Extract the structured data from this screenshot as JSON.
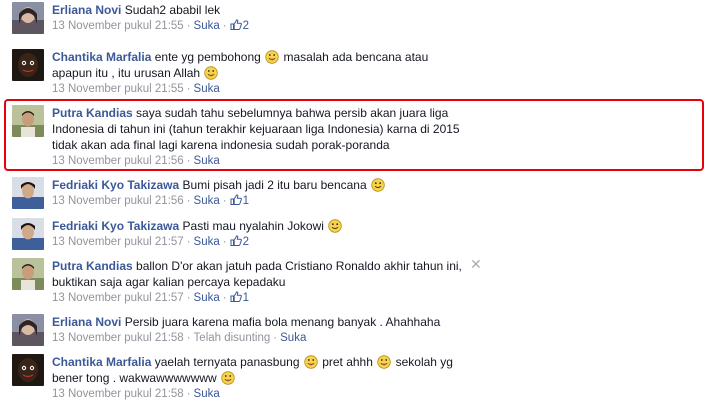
{
  "comments": [
    {
      "author": "Erliana Novi",
      "text": "Sudah2 ababil lek",
      "time": "13 November pukul 21:55",
      "like_label": "Suka",
      "like_count": "2",
      "avatar_icon": "profile-photo-woman"
    },
    {
      "author": "Chantika Marfalia",
      "text_a": "ente yg pembohong",
      "text_b": "masalah ada bencana atau",
      "text_c": "apapun itu , itu urusan Allah",
      "time": "13 November pukul 21:55",
      "like_label": "Suka",
      "avatar_icon": "profile-photo-dark"
    },
    {
      "author": "Putra Kandias",
      "line1": "saya sudah tahu sebelumnya bahwa persib akan juara liga",
      "line2": "Indonesia di tahun ini (tahun terakhir kejuaraan liga Indonesia) karna di 2015",
      "line3": "tidak akan ada final lagi karena indonesia sudah porak-poranda",
      "time": "13 November pukul 21:56",
      "like_label": "Suka",
      "avatar_icon": "profile-photo-man-outdoor"
    },
    {
      "author": "Fedriaki Kyo Takizawa",
      "text": "Bumi pisah jadi 2 itu baru bencana",
      "time": "13 November pukul 21:56",
      "like_label": "Suka",
      "like_count": "1",
      "avatar_icon": "profile-photo-man-blue"
    },
    {
      "author": "Fedriaki Kyo Takizawa",
      "text": "Pasti mau nyalahin Jokowi",
      "time": "13 November pukul 21:57",
      "like_label": "Suka",
      "like_count": "2",
      "avatar_icon": "profile-photo-man-blue"
    },
    {
      "author": "Putra Kandias",
      "line1": "ballon D'or akan jatuh pada Cristiano Ronaldo akhir tahun ini,",
      "line2": "buktikan saja agar kalian percaya kepadaku",
      "time": "13 November pukul 21:57",
      "like_label": "Suka",
      "like_count": "1",
      "close_glyph": "✕",
      "avatar_icon": "profile-photo-man-outdoor"
    },
    {
      "author": "Erliana Novi",
      "text": "Persib juara karena mafia bola menang banyak . Ahahhaha",
      "time": "13 November pukul 21:58",
      "edited_label": "Telah disunting",
      "like_label": "Suka",
      "avatar_icon": "profile-photo-woman"
    },
    {
      "author": "Chantika Marfalia",
      "text_a": "yaelah ternyata panasbung",
      "text_b": "pret ahhh",
      "text_c": "sekolah yg",
      "text_d": "bener tong . wakwawwwwwww",
      "time": "13 November pukul 21:58",
      "like_label": "Suka",
      "avatar_icon": "profile-photo-dark"
    }
  ],
  "colors": {
    "author": "#3b5998",
    "meta": "#90949c",
    "highlight": "#e8000d"
  },
  "icons": {
    "tongue": "tongue-emoticon",
    "smile": "smile-emoticon",
    "like": "thumbs-up-icon"
  }
}
